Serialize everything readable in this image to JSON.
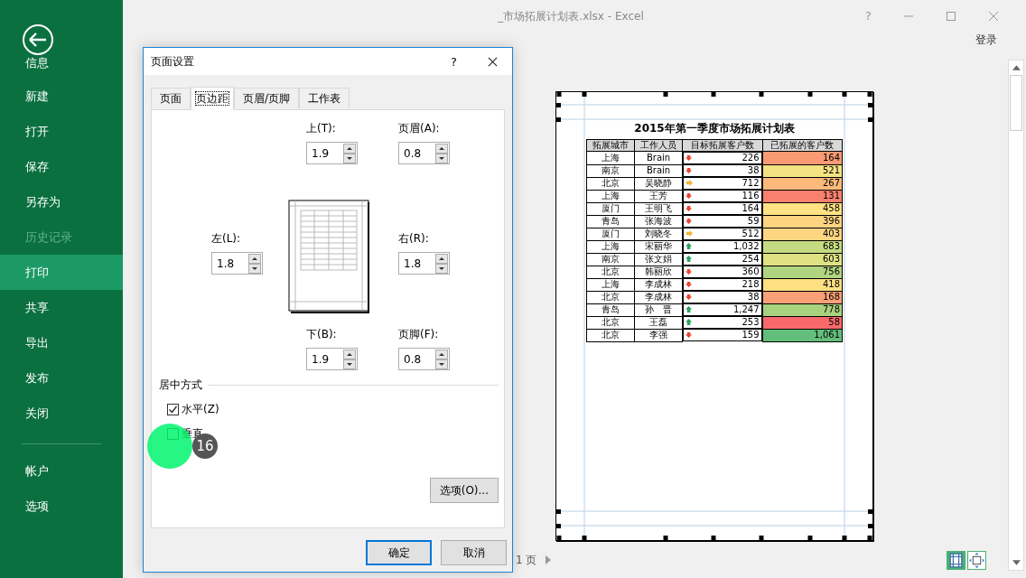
{
  "app": {
    "title": "_市场拓展计划表.xlsx - Excel",
    "help": "?",
    "signin": "登录"
  },
  "backstage": {
    "items": [
      {
        "label": "信息",
        "selected": false,
        "disabled": false
      },
      {
        "label": "新建",
        "selected": false,
        "disabled": false
      },
      {
        "label": "打开",
        "selected": false,
        "disabled": false
      },
      {
        "label": "保存",
        "selected": false,
        "disabled": false
      },
      {
        "label": "另存为",
        "selected": false,
        "disabled": false
      },
      {
        "label": "历史记录",
        "selected": false,
        "disabled": true
      },
      {
        "label": "打印",
        "selected": true,
        "disabled": false
      },
      {
        "label": "共享",
        "selected": false,
        "disabled": false
      },
      {
        "label": "导出",
        "selected": false,
        "disabled": false
      },
      {
        "label": "发布",
        "selected": false,
        "disabled": false
      },
      {
        "label": "关闭",
        "selected": false,
        "disabled": false
      }
    ],
    "footer_items": [
      {
        "label": "帐户",
        "selected": false
      },
      {
        "label": "选项",
        "selected": false
      }
    ]
  },
  "dialog": {
    "title": "页面设置",
    "help": "?",
    "tabs": [
      {
        "label": "页面",
        "selected": false
      },
      {
        "label": "页边距",
        "selected": true
      },
      {
        "label": "页眉/页脚",
        "selected": false
      },
      {
        "label": "工作表",
        "selected": false
      }
    ],
    "margins": [
      {
        "kind": "top",
        "label": "上(T):",
        "value": "1.9"
      },
      {
        "kind": "header",
        "label": "页眉(A):",
        "value": "0.8"
      },
      {
        "kind": "left",
        "label": "左(L):",
        "value": "1.8"
      },
      {
        "kind": "right",
        "label": "右(R):",
        "value": "1.8"
      },
      {
        "kind": "bottom",
        "label": "下(B):",
        "value": "1.9"
      },
      {
        "kind": "footer",
        "label": "页脚(F):",
        "value": "0.8"
      }
    ],
    "centering": {
      "title": "居中方式",
      "options": [
        {
          "label": "水平(Z)",
          "checked": true
        },
        {
          "label": "垂直",
          "checked": false
        }
      ]
    },
    "options_button": "选项(O)...",
    "buttons": [
      {
        "label": "确定",
        "default": true
      },
      {
        "label": "取消",
        "default": false
      }
    ]
  },
  "preview": {
    "title": "2015年第一季度市场拓展计划表",
    "columns": [
      "拓展城市",
      "工作人员",
      "目标拓展客户数",
      "已拓展的客户数"
    ],
    "rows": [
      {
        "city": "上海",
        "name": "Brain",
        "target": "226",
        "kind": "down",
        "done": "164",
        "color": "#f99a74"
      },
      {
        "city": "南京",
        "name": "Brain",
        "target": "38",
        "kind": "down",
        "done": "521",
        "color": "#f3e383"
      },
      {
        "city": "北京",
        "name": "吴晓静",
        "target": "712",
        "kind": "side",
        "done": "267",
        "color": "#fbb97b"
      },
      {
        "city": "上海",
        "name": "王芳",
        "target": "116",
        "kind": "down",
        "done": "131",
        "color": "#f8806e"
      },
      {
        "city": "厦门",
        "name": "王明飞",
        "target": "164",
        "kind": "down",
        "done": "458",
        "color": "#fee283"
      },
      {
        "city": "青岛",
        "name": "张海波",
        "target": "59",
        "kind": "down",
        "done": "396",
        "color": "#fed382"
      },
      {
        "city": "厦门",
        "name": "刘晓冬",
        "target": "512",
        "kind": "side",
        "done": "403",
        "color": "#fed682"
      },
      {
        "city": "上海",
        "name": "宋丽华",
        "target": "1,032",
        "kind": "up",
        "done": "683",
        "color": "#c5db81"
      },
      {
        "city": "南京",
        "name": "张文娟",
        "target": "254",
        "kind": "up",
        "done": "603",
        "color": "#dfe283"
      },
      {
        "city": "北京",
        "name": "韩丽欣",
        "target": "360",
        "kind": "down",
        "done": "756",
        "color": "#b0d480"
      },
      {
        "city": "上海",
        "name": "李成林",
        "target": "218",
        "kind": "down",
        "done": "418",
        "color": "#fee082"
      },
      {
        "city": "北京",
        "name": "李成林",
        "target": "38",
        "kind": "down",
        "done": "168",
        "color": "#f9a076"
      },
      {
        "city": "青岛",
        "name": "孙　晋",
        "target": "1,247",
        "kind": "up",
        "done": "778",
        "color": "#a9d27f"
      },
      {
        "city": "北京",
        "name": "王磊",
        "target": "253",
        "kind": "up",
        "done": "58",
        "color": "#f8696b"
      },
      {
        "city": "北京",
        "name": "李强",
        "target": "159",
        "kind": "down",
        "done": "1,061",
        "color": "#63be7b"
      }
    ]
  },
  "page_status": "1 页",
  "step_marker": {
    "number": "16"
  }
}
